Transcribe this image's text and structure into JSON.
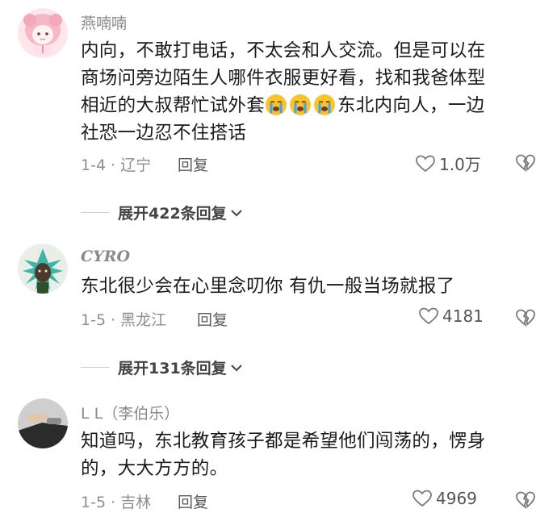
{
  "comments": [
    {
      "username": "燕喃喃",
      "text_lines": [
        "内向，不敢打电话，不太会和人交流。但是可以在",
        "商场问旁边陌生人哪件衣服更好看，找和我爸体型"
      ],
      "text_line3_before": "相近的大叔帮忙试外套",
      "text_line3_after": "东北内向人，一边",
      "text_line4": "社恐一边忍不住搭话",
      "emoji_name": "loudly-crying-face-icon",
      "date_region": "1-4 · 辽宁",
      "reply_label": "回复",
      "likes": "1.0万",
      "expand_label": "展开422条回复"
    },
    {
      "username": "CYRO",
      "text_line1": "东北很少会在心里念叨你 有仇一般当场就报了",
      "date_region": "1-5 · 黑龙江",
      "reply_label": "回复",
      "likes": "4181",
      "expand_label": "展开131条回复"
    },
    {
      "username": "L L（李伯乐）",
      "text_line1": "知道吗，东北教育孩子都是希望他们闯荡的，愣身",
      "text_line2": "的，大大方方的。",
      "date_region": "1-5 · 吉林",
      "reply_label": "回复",
      "likes": "4969"
    }
  ],
  "colors": {
    "meta_gray": "#8e8e8e",
    "text_dark": "#1a1a1a",
    "avatar1_pink": "#f6b8c6",
    "avatar2_green": "#3e6a3a",
    "emoji_yellow": "#f7c331",
    "emoji_tears": "#3ea6e8"
  }
}
